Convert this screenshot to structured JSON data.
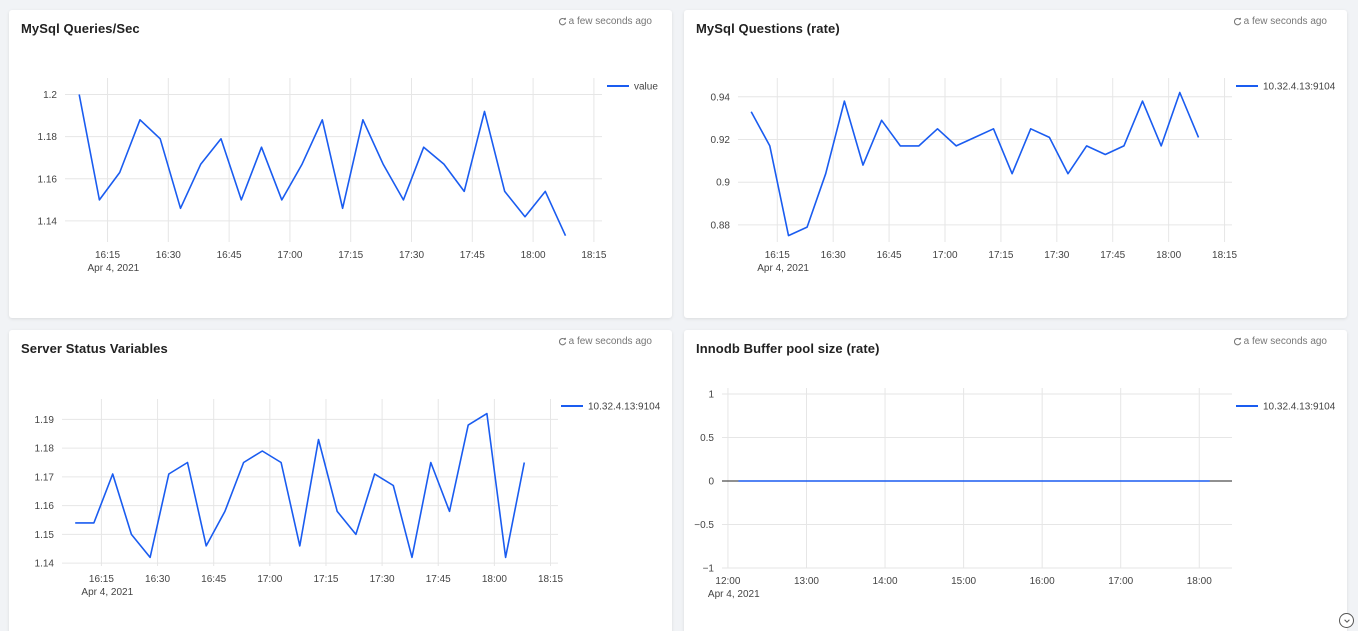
{
  "panels": [
    {
      "title": "MySql Queries/Sec",
      "refresh_text": "a few seconds ago"
    },
    {
      "title": "MySql Questions (rate)",
      "refresh_text": "a few seconds ago"
    },
    {
      "title": "Server Status Variables",
      "refresh_text": "a few seconds ago"
    },
    {
      "title": "Innodb Buffer pool size (rate)",
      "refresh_text": "a few seconds ago"
    }
  ],
  "colors": {
    "line": "#1a5cf0",
    "grid": "#e6e6e6",
    "axis_text": "#444444"
  },
  "icons": {
    "refresh": "refresh-icon",
    "scroll": "chevron-down-circle-icon"
  },
  "chart_data": [
    {
      "type": "line",
      "title": "MySql Queries/Sec",
      "x": [
        "16:08",
        "16:13",
        "16:18",
        "16:23",
        "16:28",
        "16:33",
        "16:38",
        "16:43",
        "16:48",
        "16:53",
        "16:58",
        "17:03",
        "17:08",
        "17:13",
        "17:18",
        "17:23",
        "17:28",
        "17:33",
        "17:38",
        "17:43",
        "17:48",
        "17:53",
        "17:58",
        "18:03",
        "18:08"
      ],
      "series": [
        {
          "name": "value",
          "values": [
            1.2,
            1.15,
            1.163,
            1.188,
            1.179,
            1.146,
            1.167,
            1.179,
            1.15,
            1.175,
            1.15,
            1.167,
            1.188,
            1.146,
            1.188,
            1.167,
            1.15,
            1.175,
            1.167,
            1.154,
            1.192,
            1.154,
            1.142,
            1.154,
            1.133
          ]
        }
      ],
      "ylim": [
        1.13,
        1.205
      ],
      "yticks": [
        "1.2",
        "1.18",
        "1.16",
        "1.14"
      ],
      "xticks": [
        "16:15",
        "16:30",
        "16:45",
        "17:00",
        "17:15",
        "17:30",
        "17:45",
        "18:00",
        "18:15"
      ],
      "date_label": "Apr 4, 2021",
      "legend": "right"
    },
    {
      "type": "line",
      "title": "MySql Questions (rate)",
      "x": [
        "16:08",
        "16:13",
        "16:18",
        "16:23",
        "16:28",
        "16:33",
        "16:38",
        "16:43",
        "16:48",
        "16:53",
        "16:58",
        "17:03",
        "17:08",
        "17:13",
        "17:18",
        "17:23",
        "17:28",
        "17:33",
        "17:38",
        "17:43",
        "17:48",
        "17:53",
        "17:58",
        "18:03",
        "18:08"
      ],
      "series": [
        {
          "name": "10.32.4.13:9104",
          "values": [
            0.933,
            0.917,
            0.875,
            0.879,
            0.904,
            0.938,
            0.908,
            0.929,
            0.917,
            0.917,
            0.925,
            0.917,
            0.921,
            0.925,
            0.904,
            0.925,
            0.921,
            0.904,
            0.917,
            0.913,
            0.917,
            0.938,
            0.917,
            0.942,
            0.921
          ]
        }
      ],
      "ylim": [
        0.872,
        0.946
      ],
      "yticks": [
        "0.94",
        "0.92",
        "0.9",
        "0.88"
      ],
      "xticks": [
        "16:15",
        "16:30",
        "16:45",
        "17:00",
        "17:15",
        "17:30",
        "17:45",
        "18:00",
        "18:15"
      ],
      "date_label": "Apr 4, 2021",
      "legend": "right"
    },
    {
      "type": "line",
      "title": "Server Status Variables",
      "x": [
        "16:08",
        "16:13",
        "16:18",
        "16:23",
        "16:28",
        "16:33",
        "16:38",
        "16:43",
        "16:48",
        "16:53",
        "16:58",
        "17:03",
        "17:08",
        "17:13",
        "17:18",
        "17:23",
        "17:28",
        "17:33",
        "17:38",
        "17:43",
        "17:48",
        "17:53",
        "17:58",
        "18:03",
        "18:08"
      ],
      "series": [
        {
          "name": "10.32.4.13:9104",
          "values": [
            1.154,
            1.154,
            1.171,
            1.15,
            1.142,
            1.171,
            1.175,
            1.146,
            1.158,
            1.175,
            1.179,
            1.175,
            1.146,
            1.183,
            1.158,
            1.15,
            1.171,
            1.167,
            1.142,
            1.175,
            1.158,
            1.188,
            1.192,
            1.142,
            1.175
          ]
        }
      ],
      "ylim": [
        1.139,
        1.195
      ],
      "yticks": [
        "1.19",
        "1.18",
        "1.17",
        "1.16",
        "1.15",
        "1.14"
      ],
      "xticks": [
        "16:15",
        "16:30",
        "16:45",
        "17:00",
        "17:15",
        "17:30",
        "17:45",
        "18:00",
        "18:15"
      ],
      "date_label": "Apr 4, 2021",
      "legend": "right"
    },
    {
      "type": "line",
      "title": "Innodb Buffer pool size (rate)",
      "x": [
        "12:08",
        "18:08"
      ],
      "series": [
        {
          "name": "10.32.4.13:9104",
          "values": [
            0,
            0
          ]
        }
      ],
      "ylim": [
        -1,
        1
      ],
      "yticks": [
        "1",
        "0.5",
        "0",
        "−0.5",
        "−1"
      ],
      "xticks": [
        "12:00",
        "13:00",
        "14:00",
        "15:00",
        "16:00",
        "17:00",
        "18:00"
      ],
      "date_label": "Apr 4, 2021",
      "legend": "right"
    }
  ]
}
